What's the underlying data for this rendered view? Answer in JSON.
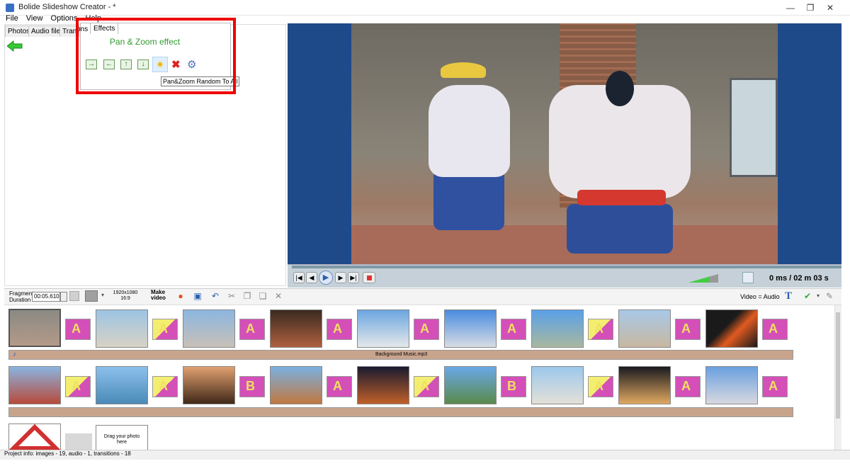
{
  "window": {
    "title": "Bolide Slideshow Creator - *",
    "minimize": "—",
    "maximize": "❐",
    "close": "✕"
  },
  "menu": [
    "File",
    "View",
    "Options",
    "Help"
  ],
  "tabs": [
    "Photos",
    "Audio files",
    "Transitions",
    "Effects"
  ],
  "tab_visible_fragments": [
    "Photos",
    "Audio files",
    "Tran",
    "ons"
  ],
  "effects": {
    "title": "Pan & Zoom effect",
    "buttons": [
      "pan-right",
      "pan-left",
      "pan-up",
      "pan-down",
      "random",
      "remove",
      "settings"
    ],
    "tooltip": "Pan&Zoom Random To All"
  },
  "player": {
    "time": "0 ms / 02 m 03 s"
  },
  "toolbar": {
    "fragment_label": "Fragment\nDuration",
    "fragment_value": "00:05.610",
    "resolution": "1920x1080\n16:9",
    "make_video": "Make\nvideo",
    "video_eq_audio": "Video = Audio"
  },
  "timeline": {
    "music_track": "Background Music.mp3",
    "drag_placeholder": "Drag your photo\nhere"
  },
  "status": {
    "project_info": "Project info: images - 19, audio - 1, transitions - 18"
  },
  "colors": {
    "accent_red": "#e00000",
    "effect_green": "#2f9a2f",
    "preview_bg": "#1e4a8a",
    "transition_magenta": "#d44fb8",
    "track_tan": "#c8a48d"
  }
}
